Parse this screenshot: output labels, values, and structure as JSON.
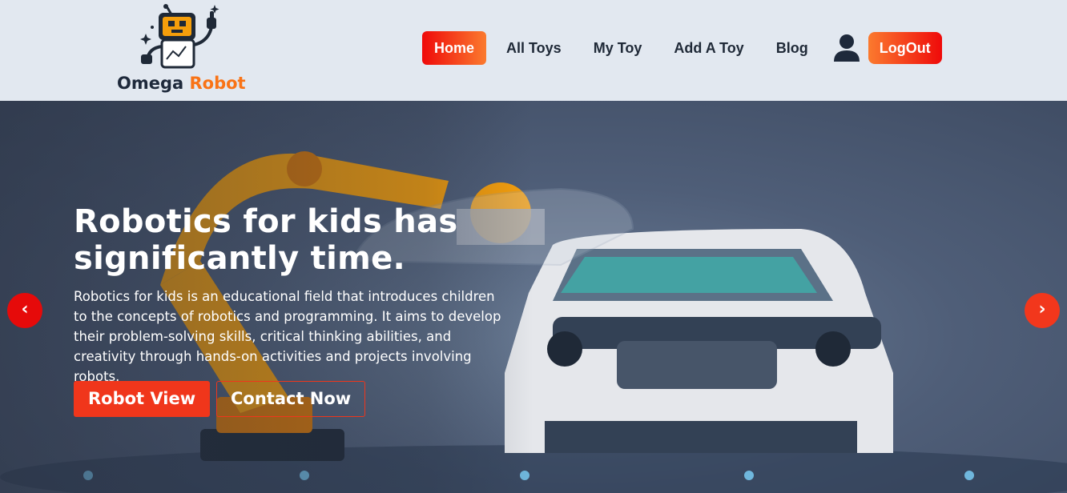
{
  "logo": {
    "name_part1": "Omega",
    "name_part2": "Robot"
  },
  "nav": {
    "items": [
      {
        "label": "Home",
        "active": true
      },
      {
        "label": "All Toys",
        "active": false
      },
      {
        "label": "My Toy",
        "active": false
      },
      {
        "label": "Add A Toy",
        "active": false
      },
      {
        "label": "Blog",
        "active": false
      }
    ],
    "user_icon": "user-icon",
    "logout_label": "LogOut"
  },
  "hero": {
    "title": "Robotics for kids has significantly time.",
    "description": "Robotics for kids is an educational field that introduces children to the concepts of robotics and programming. It aims to develop their problem-solving skills, critical thinking abilities, and creativity through hands-on activities and projects involving robots.",
    "primary_button": "Robot View",
    "secondary_button": "Contact Now",
    "prev_arrow": "‹",
    "next_arrow": "›"
  },
  "colors": {
    "accent_red": "#ef0a0a",
    "accent_orange": "#f97316",
    "header_bg": "#e2e8f0"
  }
}
